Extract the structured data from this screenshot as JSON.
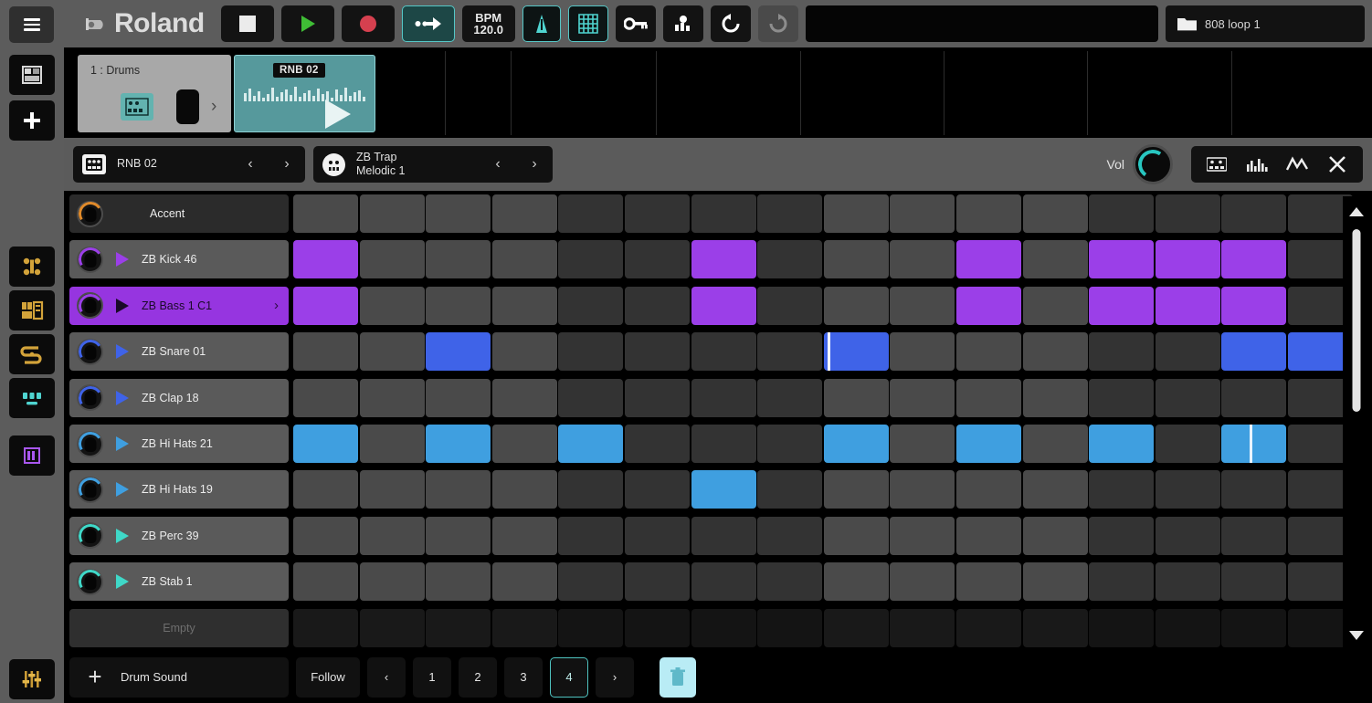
{
  "app": {
    "brand": "Roland",
    "file_name": "808 loop 1"
  },
  "left_rail": {
    "menu_icon": "hamburger-menu-icon",
    "items": [
      {
        "name": "project-browser",
        "icon": "grid-window-icon",
        "color": "#d8d8d8"
      },
      {
        "name": "add-track",
        "icon": "plus-icon",
        "color": "#ffffff"
      },
      {
        "name": "mixer",
        "icon": "mixer-nodes-icon",
        "color": "#d3a33a"
      },
      {
        "name": "instrument-rack",
        "icon": "rack-icon",
        "color": "#d3a33a"
      },
      {
        "name": "routing",
        "icon": "routing-icon",
        "color": "#d3a33a"
      },
      {
        "name": "pads",
        "icon": "pads-icon",
        "color": "#4fd4d0"
      },
      {
        "name": "step-sequencer",
        "icon": "step-bars-icon",
        "color": "#a957f0"
      },
      {
        "name": "faders",
        "icon": "faders-icon",
        "color": "#d3a33a"
      }
    ]
  },
  "toolbar": {
    "stop_label": "stop",
    "play_label": "play",
    "record_label": "record",
    "loop_label": "loop",
    "bpm_label": "BPM",
    "bpm_value": "120.0",
    "metronome_label": "metronome",
    "grid_label": "grid",
    "key_label": "key",
    "mixer_label": "mixer",
    "undo_label": "undo",
    "redo_label": "redo",
    "folder_icon": "folder-icon",
    "accent_color": "#55c7c7",
    "play_color": "#3fbd35",
    "record_color": "#d6404f"
  },
  "clip_lane": {
    "track": {
      "label": "1 : Drums",
      "instrument_icon": "drum-machine-icon",
      "expand_icon": "chevron-right-icon"
    },
    "clip": {
      "name": "RNB 02",
      "play_icon": "play-triangle-icon",
      "color": "#56999c"
    }
  },
  "pattern_header": {
    "pattern": {
      "icon": "pattern-grid-icon",
      "name": "RNB 02",
      "prev": "‹",
      "next": "›"
    },
    "kit": {
      "icon": "kit-circle-icon",
      "name_line1": "ZB Trap",
      "name_line2": "Melodic 1",
      "prev": "‹",
      "next": "›"
    },
    "volume_label": "Vol",
    "tray": [
      {
        "name": "pattern-view-icon",
        "label": "pattern"
      },
      {
        "name": "velocity-bars-icon",
        "label": "velocity"
      },
      {
        "name": "automation-curve-icon",
        "label": "automation"
      },
      {
        "name": "close-icon",
        "label": "✕"
      }
    ]
  },
  "sequencer": {
    "step_count": 16,
    "rows": [
      {
        "name": "Accent",
        "type": "accent",
        "color": "#e08a2a",
        "selected": false,
        "steps": []
      },
      {
        "name": "ZB Kick 46",
        "type": "drum",
        "color": "#9b3fe8",
        "selected": false,
        "steps": [
          1,
          7,
          11,
          13,
          14,
          15
        ]
      },
      {
        "name": "ZB Bass 1 C1",
        "type": "drum",
        "color": "#9b3fe8",
        "selected": true,
        "steps": [
          1,
          7,
          11,
          13,
          14,
          15
        ]
      },
      {
        "name": "ZB Snare 01",
        "type": "drum",
        "color": "#3f63e8",
        "selected": false,
        "steps": [
          3,
          9,
          15,
          16
        ],
        "tick_steps": [
          9
        ]
      },
      {
        "name": "ZB Clap 18",
        "type": "drum",
        "color": "#3f63e8",
        "selected": false,
        "steps": []
      },
      {
        "name": "ZB Hi Hats 21",
        "type": "drum",
        "color": "#3f9fe0",
        "selected": false,
        "steps": [
          1,
          3,
          5,
          9,
          11,
          13,
          15
        ],
        "tick2_steps": [
          15
        ]
      },
      {
        "name": "ZB Hi Hats 19",
        "type": "drum",
        "color": "#3f9fe0",
        "selected": false,
        "steps": [
          7
        ]
      },
      {
        "name": "ZB Perc 39",
        "type": "drum",
        "color": "#3fd8c8",
        "selected": false,
        "steps": []
      },
      {
        "name": "ZB Stab 1",
        "type": "drum",
        "color": "#3fd8c8",
        "selected": false,
        "steps": []
      },
      {
        "name": "Empty",
        "type": "empty",
        "color": "#6e6e6e",
        "selected": false,
        "steps": []
      }
    ]
  },
  "scrollbar": {
    "up_icon": "triangle-up-icon",
    "down_icon": "triangle-down-icon"
  },
  "bottom_bar": {
    "add_label": "Drum Sound",
    "add_icon": "plus-icon",
    "follow_label": "Follow",
    "prev_page": "‹",
    "next_page": "›",
    "pages": [
      "1",
      "2",
      "3",
      "4"
    ],
    "selected_page": "4",
    "trash_icon": "delete-icon"
  }
}
